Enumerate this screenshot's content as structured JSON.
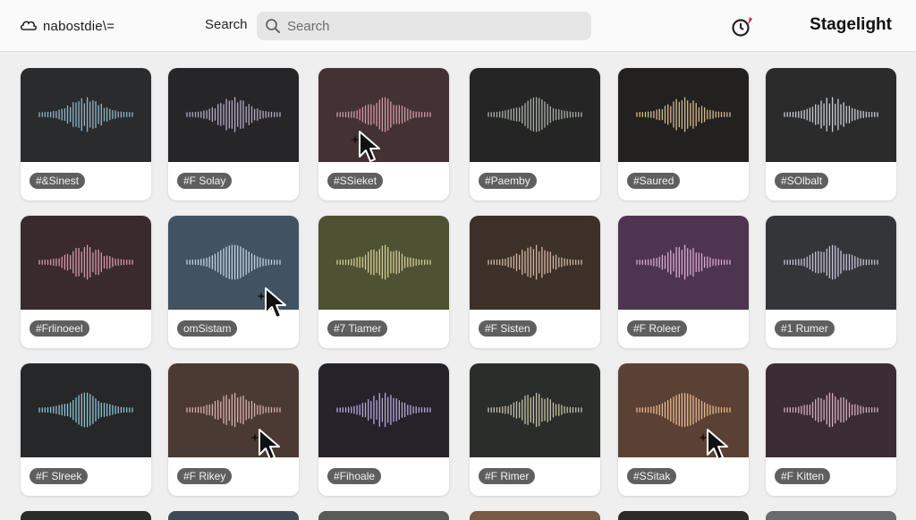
{
  "header": {
    "brand_text": "nabostdie\\=",
    "search_label": "Search",
    "search_placeholder": "Search",
    "app_name": "Stagelight",
    "notification_icon": "timer-alert-icon"
  },
  "tracks": [
    {
      "tag": "#&Sinest",
      "bg": "#2a2b2d",
      "wave": "#8fb6c8"
    },
    {
      "tag": "#F Solay",
      "bg": "#262629",
      "wave": "#b2a9c4"
    },
    {
      "tag": "#SSieket",
      "bg": "#433133",
      "wave": "#cf9aa3"
    },
    {
      "tag": "#Paemby",
      "bg": "#252525",
      "wave": "#a8b2a6"
    },
    {
      "tag": "#Saured",
      "bg": "#222120",
      "wave": "#d6b98a"
    },
    {
      "tag": "#SOlbalt",
      "bg": "#2b2b2b",
      "wave": "#c9cdd3"
    },
    {
      "tag": "#Frlinoeel",
      "bg": "#3a292d",
      "wave": "#d49aa9"
    },
    {
      "tag": "omSistam",
      "bg": "#415262",
      "wave": "#c3d1de"
    },
    {
      "tag": "#7 Tiamer",
      "bg": "#4e5132",
      "wave": "#d3cc98"
    },
    {
      "tag": "#F Sisten",
      "bg": "#3c3028",
      "wave": "#d2b7a4"
    },
    {
      "tag": "#F Roleer",
      "bg": "#4e3450",
      "wave": "#d8a9d0"
    },
    {
      "tag": "#1 Rumer",
      "bg": "#343539",
      "wave": "#c7c0d6"
    },
    {
      "tag": "#F Slreek",
      "bg": "#252729",
      "wave": "#8ec3d4"
    },
    {
      "tag": "#F Rikey",
      "bg": "#4a3a33",
      "wave": "#d8b0b0"
    },
    {
      "tag": "#Fihoale",
      "bg": "#25222a",
      "wave": "#b7a8d6"
    },
    {
      "tag": "#F Rimer",
      "bg": "#2a2d2a",
      "wave": "#c5c2a8"
    },
    {
      "tag": "#SSitak",
      "bg": "#5a4133",
      "wave": "#e6b992"
    },
    {
      "tag": "#F Kitten",
      "bg": "#3b2c33",
      "wave": "#d6aebf"
    }
  ],
  "partial_row_colors": [
    "#2b2b2b",
    "#3d4a55",
    "#5a5a5a",
    "#7a5a44",
    "#2c2a2a",
    "#6a6a70"
  ],
  "cursor_icon": "mouse-pointer-icon"
}
